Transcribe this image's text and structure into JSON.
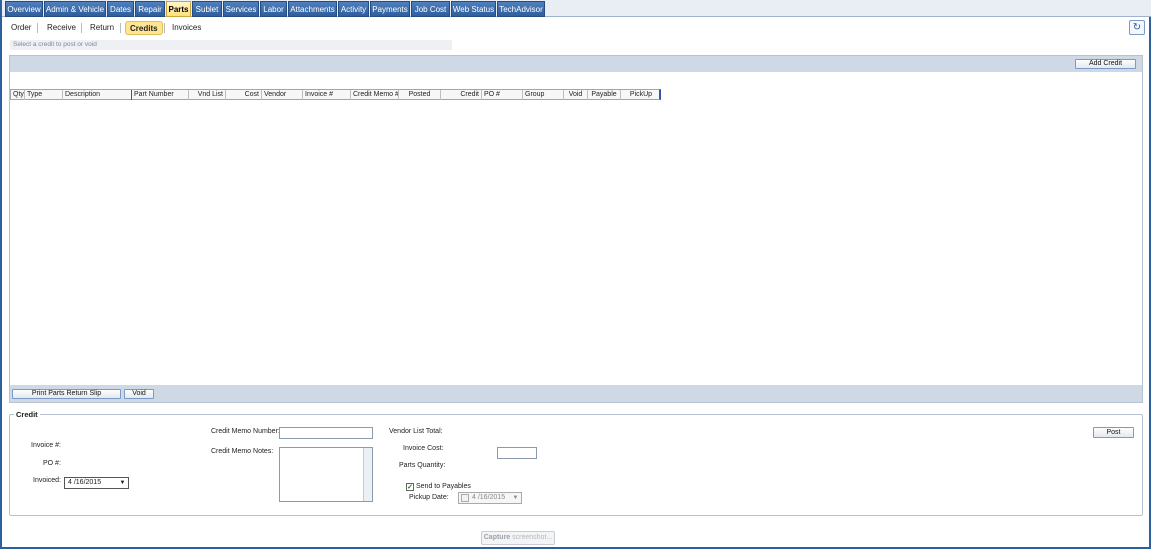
{
  "tabs": [
    {
      "label": "Overview",
      "active": false
    },
    {
      "label": "Admin & Vehicle",
      "active": false
    },
    {
      "label": "Dates",
      "active": false
    },
    {
      "label": "Repair",
      "active": false
    },
    {
      "label": "Parts",
      "active": true
    },
    {
      "label": "Sublet",
      "active": false
    },
    {
      "label": "Services",
      "active": false
    },
    {
      "label": "Labor",
      "active": false
    },
    {
      "label": "Attachments",
      "active": false
    },
    {
      "label": "Activity",
      "active": false
    },
    {
      "label": "Payments",
      "active": false
    },
    {
      "label": "Job Cost",
      "active": false
    },
    {
      "label": "Web Status",
      "active": false
    },
    {
      "label": "TechAdvisor",
      "active": false
    }
  ],
  "subtabs": [
    {
      "label": "Order",
      "active": false
    },
    {
      "label": "Receive",
      "active": false
    },
    {
      "label": "Return",
      "active": false
    },
    {
      "label": "Credits",
      "active": true
    },
    {
      "label": "Invoices",
      "active": false
    }
  ],
  "hint": "Select a credit to post or void",
  "toolbar": {
    "add_credit": "Add Credit",
    "refresh_icon": "refresh-icon"
  },
  "grid": {
    "columns": [
      "Qty",
      "Type",
      "Description",
      "Part Number",
      "Vnd List",
      "Cost",
      "Vendor",
      "Invoice #",
      "Credit Memo #",
      "Posted",
      "Credit",
      "PO #",
      "Group",
      "Void",
      "Payable",
      "PickUp"
    ],
    "rows": []
  },
  "footer": {
    "print_slip": "Print Parts Return Slip",
    "void": "Void"
  },
  "credit": {
    "title": "Credit",
    "invoice_label": "Invoice #:",
    "po_label": "PO #:",
    "invoiced_label": "Invoiced:",
    "invoiced_value": "4 /16/2015",
    "credit_memo_number_label": "Credit Memo Number:",
    "credit_memo_number_value": "",
    "credit_memo_notes_label": "Credit Memo Notes:",
    "vendor_list_total_label": "Vendor List Total:",
    "invoice_cost_label": "Invoice Cost:",
    "invoice_cost_value": "",
    "parts_quantity_label": "Parts Quantity:",
    "send_to_payables_label": "Send to Payables",
    "send_to_payables_checked": true,
    "pickup_date_label": "Pickup Date:",
    "pickup_date_value": "4 /16/2015",
    "post_label": "Post"
  },
  "capture": {
    "bold": "Capture",
    "rest": " screenshot..."
  }
}
